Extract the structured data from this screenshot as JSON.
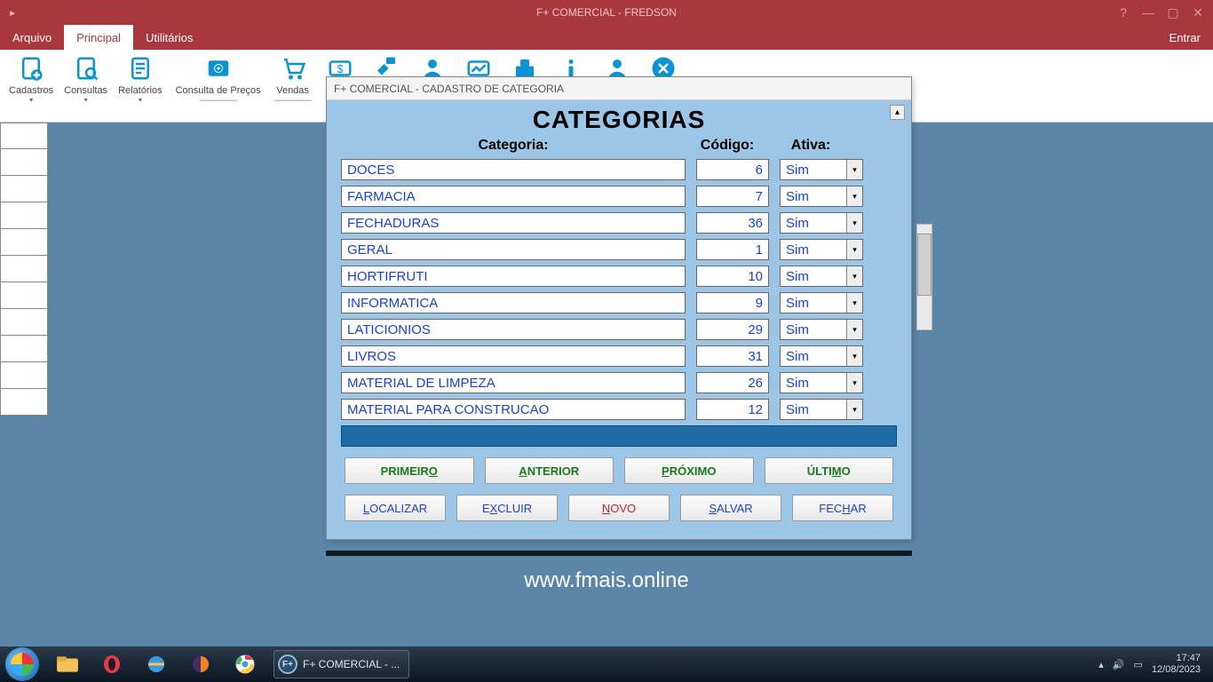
{
  "titlebar": {
    "title": "F+ COMERCIAL - FREDSON"
  },
  "menu": {
    "arquivo": "Arquivo",
    "principal": "Principal",
    "utilitarios": "Utilitários",
    "entrar": "Entrar"
  },
  "ribbon": {
    "cadastros": "Cadastros",
    "consultas": "Consultas",
    "relatorios": "Relatórios",
    "consulta_precos": "Consulta de Preços",
    "vendas": "Vendas",
    "dashes": "------------------"
  },
  "dialog": {
    "title": "F+ COMERCIAL - CADASTRO DE CATEGORIA",
    "heading": "CATEGORIAS",
    "col_categoria": "Categoria:",
    "col_codigo": "Código:",
    "col_ativa": "Ativa:",
    "rows": [
      {
        "categoria": "DOCES",
        "codigo": "6",
        "ativa": "Sim"
      },
      {
        "categoria": "FARMACIA",
        "codigo": "7",
        "ativa": "Sim"
      },
      {
        "categoria": "FECHADURAS",
        "codigo": "36",
        "ativa": "Sim"
      },
      {
        "categoria": "GERAL",
        "codigo": "1",
        "ativa": "Sim"
      },
      {
        "categoria": "HORTIFRUTI",
        "codigo": "10",
        "ativa": "Sim"
      },
      {
        "categoria": "INFORMATICA",
        "codigo": "9",
        "ativa": "Sim"
      },
      {
        "categoria": "LATICIONIOS",
        "codigo": "29",
        "ativa": "Sim"
      },
      {
        "categoria": "LIVROS",
        "codigo": "31",
        "ativa": "Sim"
      },
      {
        "categoria": "MATERIAL DE LIMPEZA",
        "codigo": "26",
        "ativa": "Sim"
      },
      {
        "categoria": "MATERIAL PARA CONSTRUCAO",
        "codigo": "12",
        "ativa": "Sim"
      }
    ],
    "nav": {
      "primeiro": "PRIMEIRO",
      "anterior": "ANTERIOR",
      "proximo": "PRÓXIMO",
      "ultimo": "ÚLTIMO"
    },
    "act": {
      "localizar": "LOCALIZAR",
      "excluir": "EXCLUIR",
      "novo": "NOVO",
      "salvar": "SALVAR",
      "fechar": "FECHAR"
    }
  },
  "footer_url": "www.fmais.online",
  "taskbar": {
    "app_label": "F+ COMERCIAL - ...",
    "time": "17:47",
    "date": "12/08/2023"
  }
}
